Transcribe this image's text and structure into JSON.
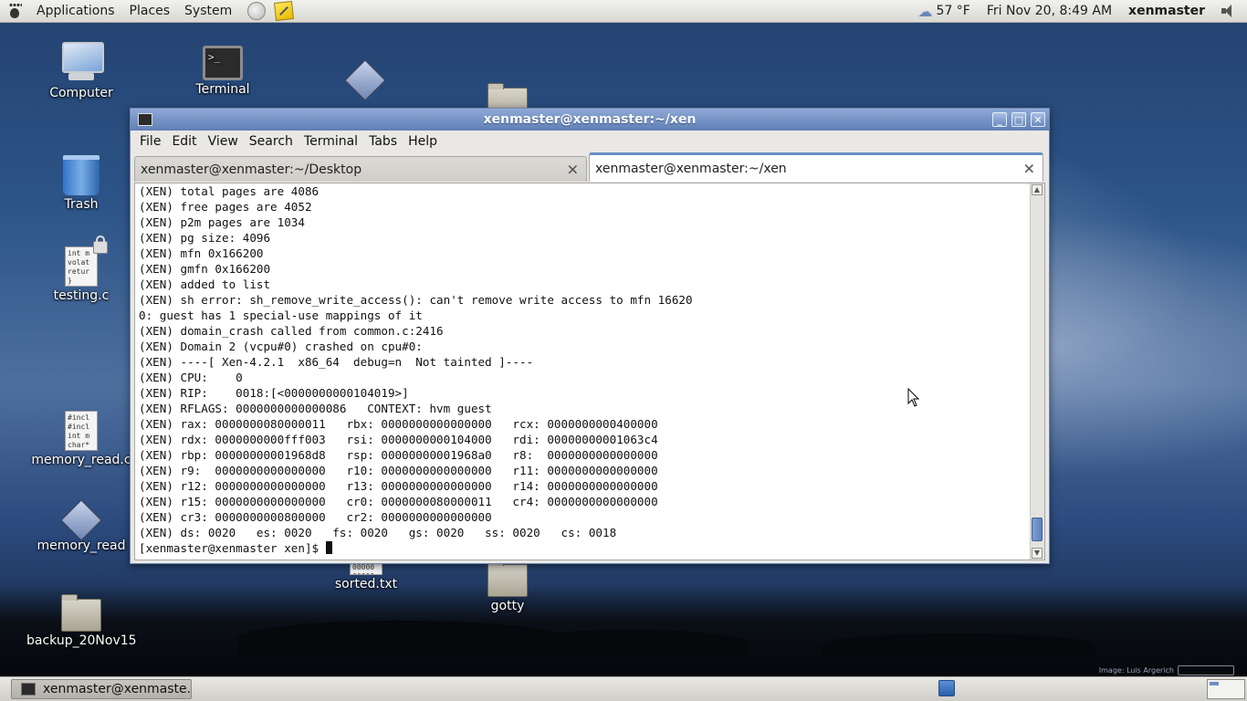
{
  "top_panel": {
    "menus": [
      "Applications",
      "Places",
      "System"
    ],
    "weather": "57 °F",
    "datetime": "Fri Nov 20,  8:49 AM",
    "user": "xenmaster"
  },
  "desktop_icons": {
    "computer": "Computer",
    "terminal": "Terminal",
    "trash": "Trash",
    "testing": "testing.c",
    "testing_preview": "int m\nvolat\nretur\n}",
    "memory_read_c": "memory_read.c",
    "memory_read_c_preview": "#incl\n#incl\nint m\nchar*",
    "memory_read": "memory_read",
    "sorted": "sorted.txt",
    "sorted_preview": "00000\n00000",
    "gotty": "gotty",
    "backup": "backup_20Nov15"
  },
  "window": {
    "title": "xenmaster@xenmaster:~/xen",
    "menus": [
      "File",
      "Edit",
      "View",
      "Search",
      "Terminal",
      "Tabs",
      "Help"
    ],
    "tabs": [
      {
        "label": "xenmaster@xenmaster:~/Desktop",
        "active": false
      },
      {
        "label": "xenmaster@xenmaster:~/xen",
        "active": true
      }
    ],
    "terminal_lines": [
      "(XEN) total pages are 4086",
      "(XEN) free pages are 4052",
      "(XEN) p2m pages are 1034",
      "(XEN) pg size: 4096",
      "(XEN) mfn 0x166200",
      "(XEN) gmfn 0x166200",
      "(XEN) added to list",
      "(XEN) sh error: sh_remove_write_access(): can't remove write access to mfn 16620",
      "0: guest has 1 special-use mappings of it",
      "(XEN) domain_crash called from common.c:2416",
      "(XEN) Domain 2 (vcpu#0) crashed on cpu#0:",
      "(XEN) ----[ Xen-4.2.1  x86_64  debug=n  Not tainted ]----",
      "(XEN) CPU:    0",
      "(XEN) RIP:    0018:[<0000000000104019>]",
      "(XEN) RFLAGS: 0000000000000086   CONTEXT: hvm guest",
      "(XEN) rax: 0000000080000011   rbx: 0000000000000000   rcx: 0000000000400000",
      "(XEN) rdx: 0000000000fff003   rsi: 0000000000104000   rdi: 00000000001063c4",
      "(XEN) rbp: 00000000001968d8   rsp: 00000000001968a0   r8:  0000000000000000",
      "(XEN) r9:  0000000000000000   r10: 0000000000000000   r11: 0000000000000000",
      "(XEN) r12: 0000000000000000   r13: 0000000000000000   r14: 0000000000000000",
      "(XEN) r15: 0000000000000000   cr0: 0000000080000011   cr4: 0000000000000000",
      "(XEN) cr3: 0000000000800000   cr2: 0000000000000000",
      "(XEN) ds: 0020   es: 0020   fs: 0020   gs: 0020   ss: 0020   cs: 0018"
    ],
    "prompt": "[xenmaster@xenmaster xen]$ "
  },
  "bottom_panel": {
    "task_label": "xenmaster@xenmaste..."
  },
  "wallpaper_credit": "Image: Luis Argerich"
}
